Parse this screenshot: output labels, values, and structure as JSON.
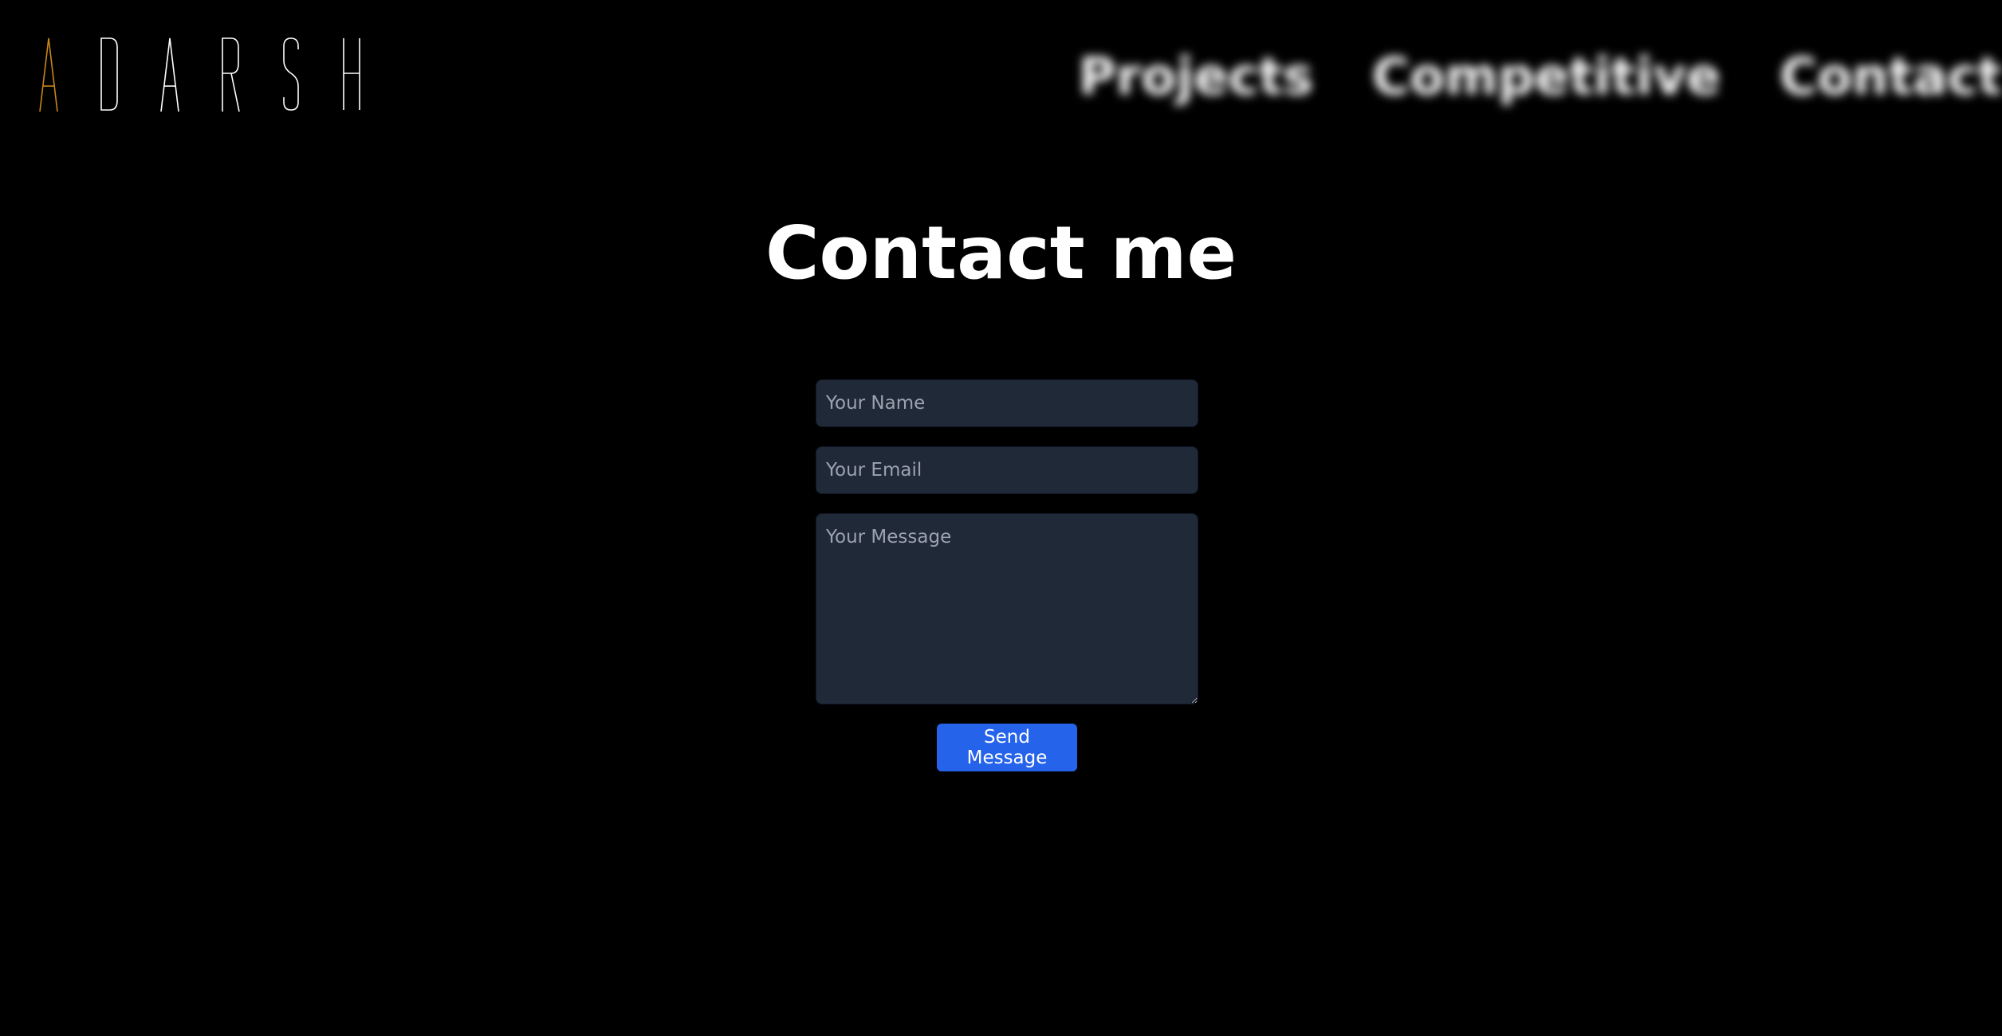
{
  "header": {
    "logo": {
      "text": "ADARSH",
      "letters": [
        "A",
        "D",
        "A",
        "R",
        "S",
        "H"
      ],
      "accent_color": "#c8861a",
      "text_color": "#ffffff"
    },
    "nav": {
      "items": [
        {
          "label": "Projects"
        },
        {
          "label": "Competitive"
        },
        {
          "label": "Contact"
        }
      ]
    }
  },
  "main": {
    "title": "Contact me",
    "form": {
      "name_placeholder": "Your Name",
      "name_value": "",
      "email_placeholder": "Your Email",
      "email_value": "",
      "message_placeholder": "Your Message",
      "message_value": "",
      "submit_label": "Send Message"
    }
  },
  "colors": {
    "background": "#000000",
    "input_background": "#1f2937",
    "placeholder": "#9ca3af",
    "button": "#2563eb"
  }
}
